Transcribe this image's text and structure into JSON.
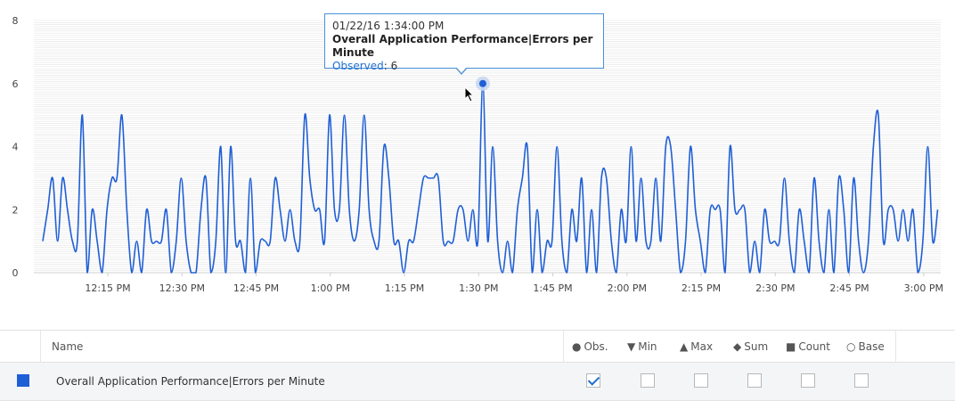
{
  "chart_data": {
    "type": "line",
    "title": "",
    "xlabel": "",
    "ylabel": "",
    "ylim": [
      0,
      8
    ],
    "y_ticks": [
      0,
      2,
      4,
      6,
      8
    ],
    "x_tick_labels": [
      "12:15 PM",
      "12:30 PM",
      "12:45 PM",
      "1:00 PM",
      "1:15 PM",
      "1:30 PM",
      "1:45 PM",
      "2:00 PM",
      "2:15 PM",
      "2:30 PM",
      "2:45 PM",
      "3:00 PM"
    ],
    "x_start_label": "12:04 PM",
    "x_interval_minutes": 1,
    "grid": true,
    "series": [
      {
        "name": "Overall Application Performance|Errors per Minute",
        "color": "#1f5fd6",
        "values": [
          1,
          2,
          3,
          1,
          3,
          2,
          1,
          1,
          5,
          0,
          2,
          1,
          0,
          2,
          3,
          3,
          5,
          2,
          0,
          1,
          0,
          2,
          1,
          1,
          1,
          2,
          0,
          1,
          3,
          1,
          0,
          0,
          2,
          3,
          0,
          1,
          4,
          0,
          4,
          1,
          1,
          0,
          3,
          0,
          1,
          1,
          1,
          3,
          2,
          1,
          2,
          1,
          1,
          5,
          3,
          2,
          2,
          1,
          5,
          2,
          2,
          5,
          2,
          1,
          2,
          5,
          2,
          1,
          1,
          4,
          3,
          1,
          1,
          0,
          1,
          1,
          2,
          3,
          3,
          3,
          3,
          1,
          1,
          1,
          2,
          2,
          1,
          2,
          1,
          6,
          1,
          4,
          1,
          0,
          1,
          0,
          2,
          3,
          4,
          0,
          2,
          0,
          1,
          1,
          4,
          1,
          0,
          2,
          1,
          3,
          0,
          2,
          0,
          3,
          3,
          1,
          0,
          2,
          1,
          4,
          1,
          3,
          1,
          1,
          3,
          1,
          4,
          4,
          2,
          0,
          1,
          4,
          2,
          1,
          0,
          2,
          2,
          2,
          0,
          4,
          2,
          2,
          2,
          0,
          1,
          0,
          2,
          1,
          1,
          1,
          3,
          1,
          0,
          2,
          1,
          0,
          3,
          1,
          0,
          2,
          0,
          3,
          2,
          0,
          3,
          1,
          0,
          1,
          4,
          5,
          1,
          2,
          2,
          1,
          2,
          1,
          2,
          0,
          1,
          4,
          1,
          2
        ]
      }
    ],
    "highlight": {
      "index": 89,
      "time": "01/22/16 1:34:00 PM",
      "value": 6
    }
  },
  "tooltip": {
    "time": "01/22/16 1:34:00 PM",
    "metric": "Overall Application Performance|Errors per Minute",
    "label": "Observed",
    "value": "6"
  },
  "legend": {
    "name_header": "Name",
    "columns": [
      {
        "symbol": "●",
        "label": "Obs.",
        "checked": true
      },
      {
        "symbol": "▼",
        "label": "Min",
        "checked": false
      },
      {
        "symbol": "▲",
        "label": "Max",
        "checked": false
      },
      {
        "symbol": "◆",
        "label": "Sum",
        "checked": false
      },
      {
        "symbol": "■",
        "label": "Count",
        "checked": false
      },
      {
        "symbol": "○",
        "label": "Base",
        "checked": false
      }
    ],
    "rows": [
      {
        "name": "Overall Application Performance|Errors per Minute",
        "color": "#1f5fd6"
      }
    ]
  }
}
